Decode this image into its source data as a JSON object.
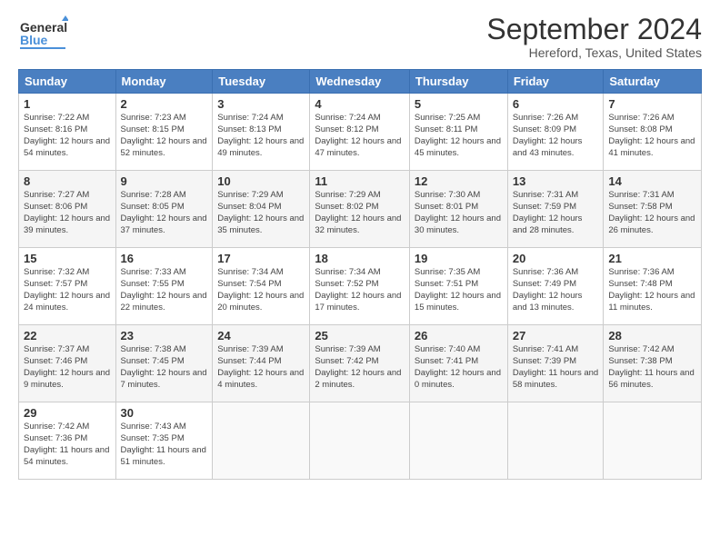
{
  "header": {
    "logo_general": "General",
    "logo_blue": "Blue",
    "title": "September 2024",
    "subtitle": "Hereford, Texas, United States"
  },
  "columns": [
    "Sunday",
    "Monday",
    "Tuesday",
    "Wednesday",
    "Thursday",
    "Friday",
    "Saturday"
  ],
  "weeks": [
    [
      {
        "day": "1",
        "info": "Sunrise: 7:22 AM\nSunset: 8:16 PM\nDaylight: 12 hours\nand 54 minutes."
      },
      {
        "day": "2",
        "info": "Sunrise: 7:23 AM\nSunset: 8:15 PM\nDaylight: 12 hours\nand 52 minutes."
      },
      {
        "day": "3",
        "info": "Sunrise: 7:24 AM\nSunset: 8:13 PM\nDaylight: 12 hours\nand 49 minutes."
      },
      {
        "day": "4",
        "info": "Sunrise: 7:24 AM\nSunset: 8:12 PM\nDaylight: 12 hours\nand 47 minutes."
      },
      {
        "day": "5",
        "info": "Sunrise: 7:25 AM\nSunset: 8:11 PM\nDaylight: 12 hours\nand 45 minutes."
      },
      {
        "day": "6",
        "info": "Sunrise: 7:26 AM\nSunset: 8:09 PM\nDaylight: 12 hours\nand 43 minutes."
      },
      {
        "day": "7",
        "info": "Sunrise: 7:26 AM\nSunset: 8:08 PM\nDaylight: 12 hours\nand 41 minutes."
      }
    ],
    [
      {
        "day": "8",
        "info": "Sunrise: 7:27 AM\nSunset: 8:06 PM\nDaylight: 12 hours\nand 39 minutes."
      },
      {
        "day": "9",
        "info": "Sunrise: 7:28 AM\nSunset: 8:05 PM\nDaylight: 12 hours\nand 37 minutes."
      },
      {
        "day": "10",
        "info": "Sunrise: 7:29 AM\nSunset: 8:04 PM\nDaylight: 12 hours\nand 35 minutes."
      },
      {
        "day": "11",
        "info": "Sunrise: 7:29 AM\nSunset: 8:02 PM\nDaylight: 12 hours\nand 32 minutes."
      },
      {
        "day": "12",
        "info": "Sunrise: 7:30 AM\nSunset: 8:01 PM\nDaylight: 12 hours\nand 30 minutes."
      },
      {
        "day": "13",
        "info": "Sunrise: 7:31 AM\nSunset: 7:59 PM\nDaylight: 12 hours\nand 28 minutes."
      },
      {
        "day": "14",
        "info": "Sunrise: 7:31 AM\nSunset: 7:58 PM\nDaylight: 12 hours\nand 26 minutes."
      }
    ],
    [
      {
        "day": "15",
        "info": "Sunrise: 7:32 AM\nSunset: 7:57 PM\nDaylight: 12 hours\nand 24 minutes."
      },
      {
        "day": "16",
        "info": "Sunrise: 7:33 AM\nSunset: 7:55 PM\nDaylight: 12 hours\nand 22 minutes."
      },
      {
        "day": "17",
        "info": "Sunrise: 7:34 AM\nSunset: 7:54 PM\nDaylight: 12 hours\nand 20 minutes."
      },
      {
        "day": "18",
        "info": "Sunrise: 7:34 AM\nSunset: 7:52 PM\nDaylight: 12 hours\nand 17 minutes."
      },
      {
        "day": "19",
        "info": "Sunrise: 7:35 AM\nSunset: 7:51 PM\nDaylight: 12 hours\nand 15 minutes."
      },
      {
        "day": "20",
        "info": "Sunrise: 7:36 AM\nSunset: 7:49 PM\nDaylight: 12 hours\nand 13 minutes."
      },
      {
        "day": "21",
        "info": "Sunrise: 7:36 AM\nSunset: 7:48 PM\nDaylight: 12 hours\nand 11 minutes."
      }
    ],
    [
      {
        "day": "22",
        "info": "Sunrise: 7:37 AM\nSunset: 7:46 PM\nDaylight: 12 hours\nand 9 minutes."
      },
      {
        "day": "23",
        "info": "Sunrise: 7:38 AM\nSunset: 7:45 PM\nDaylight: 12 hours\nand 7 minutes."
      },
      {
        "day": "24",
        "info": "Sunrise: 7:39 AM\nSunset: 7:44 PM\nDaylight: 12 hours\nand 4 minutes."
      },
      {
        "day": "25",
        "info": "Sunrise: 7:39 AM\nSunset: 7:42 PM\nDaylight: 12 hours\nand 2 minutes."
      },
      {
        "day": "26",
        "info": "Sunrise: 7:40 AM\nSunset: 7:41 PM\nDaylight: 12 hours\nand 0 minutes."
      },
      {
        "day": "27",
        "info": "Sunrise: 7:41 AM\nSunset: 7:39 PM\nDaylight: 11 hours\nand 58 minutes."
      },
      {
        "day": "28",
        "info": "Sunrise: 7:42 AM\nSunset: 7:38 PM\nDaylight: 11 hours\nand 56 minutes."
      }
    ],
    [
      {
        "day": "29",
        "info": "Sunrise: 7:42 AM\nSunset: 7:36 PM\nDaylight: 11 hours\nand 54 minutes."
      },
      {
        "day": "30",
        "info": "Sunrise: 7:43 AM\nSunset: 7:35 PM\nDaylight: 11 hours\nand 51 minutes."
      },
      {
        "day": "",
        "info": ""
      },
      {
        "day": "",
        "info": ""
      },
      {
        "day": "",
        "info": ""
      },
      {
        "day": "",
        "info": ""
      },
      {
        "day": "",
        "info": ""
      }
    ]
  ]
}
